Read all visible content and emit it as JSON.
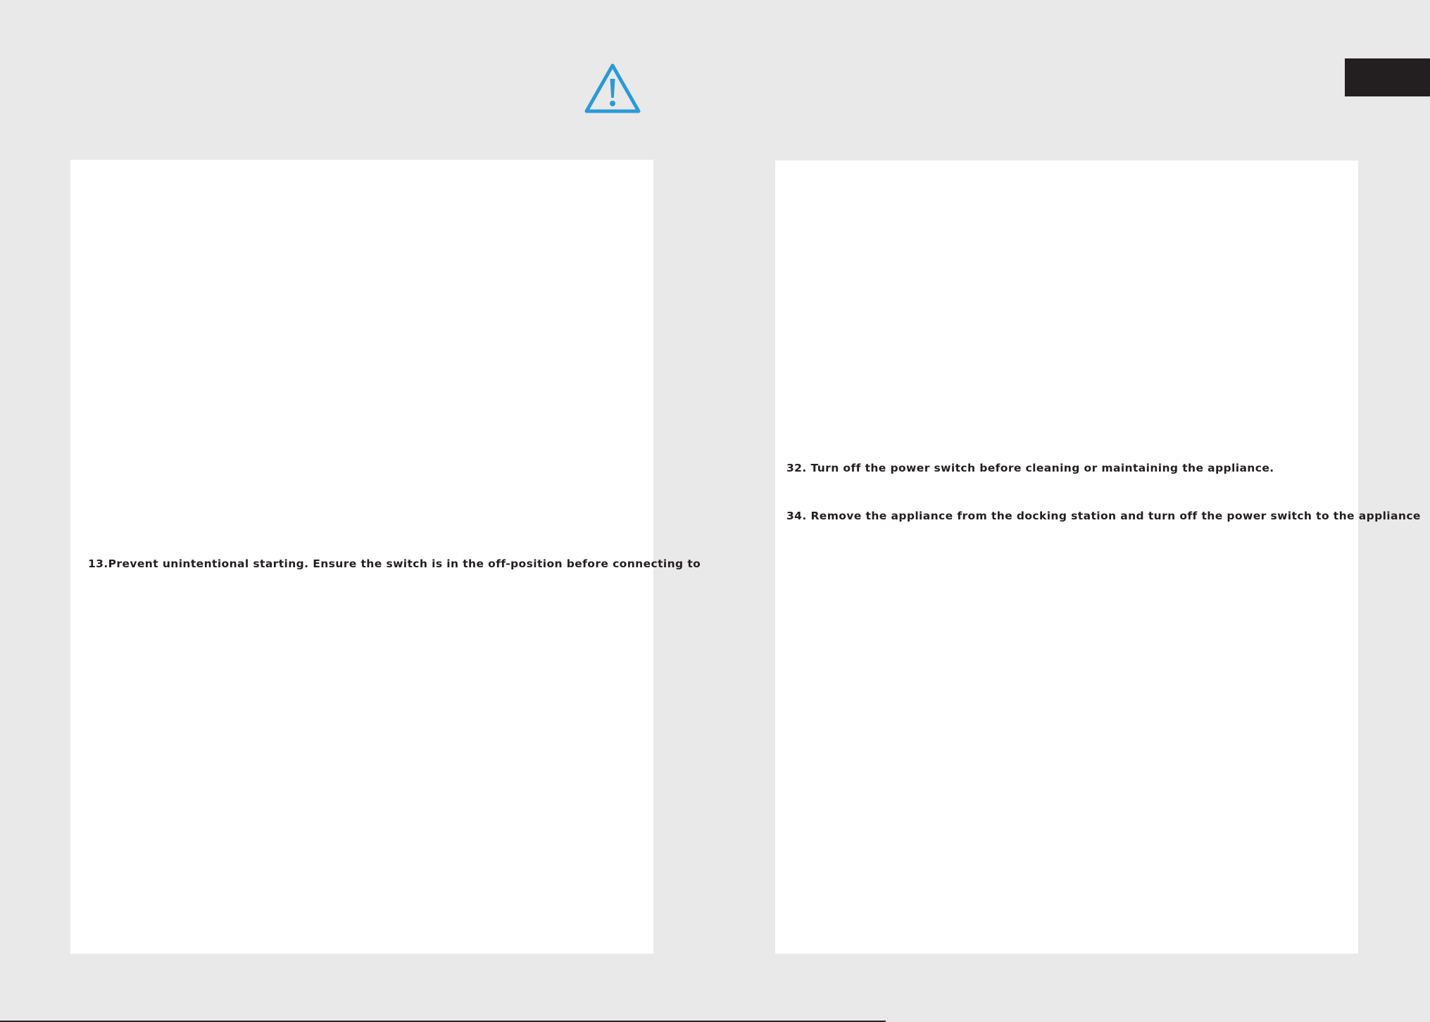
{
  "header": {
    "warning_icon": "warning-triangle-icon",
    "accent_color": "#2a9ad6",
    "tab_color": "#231f20"
  },
  "left_page": {
    "items": [
      "13.Prevent unintentional starting. Ensure the switch is in the off-position before connecting to"
    ]
  },
  "right_page": {
    "items": [
      "32. Turn off the power switch before cleaning or maintaining the appliance.",
      "34. Remove the appliance from the docking station and turn off the power switch to the appliance"
    ]
  }
}
